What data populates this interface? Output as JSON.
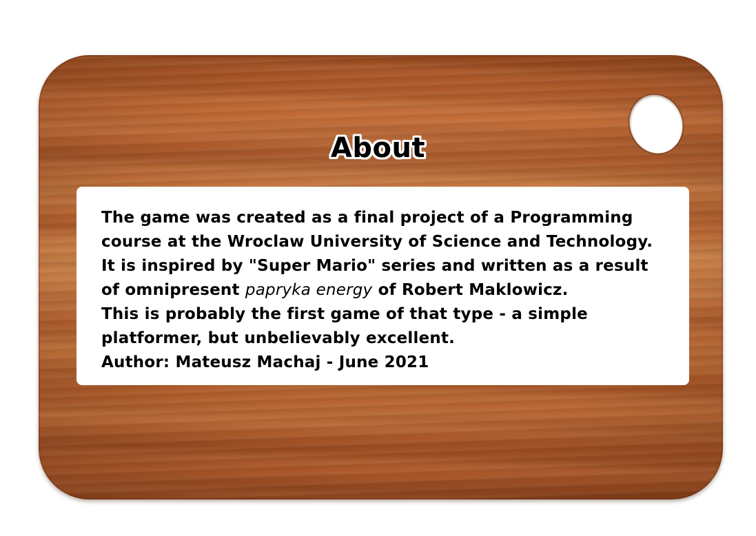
{
  "title": "About",
  "about": {
    "line1": "The game was created as a final project of a Programming",
    "line2": "course at the Wroclaw University of Science and Technology.",
    "line3": "It is inspired by \"Super Mario\" series and written as a result",
    "line4_before": "of omnipresent ",
    "line4_emphasis": "papryka energy",
    "line4_after": " of Robert Maklowicz.",
    "line5": "This is probably the first game of that type - a simple",
    "line6": "platformer, but unbelievably excellent.",
    "author": "Author: Mateusz Machaj - June 2021"
  }
}
